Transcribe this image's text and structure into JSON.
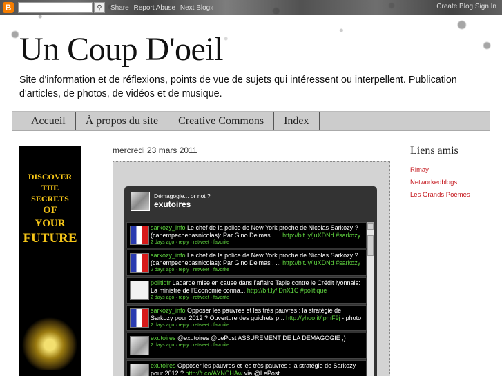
{
  "navbar": {
    "logo": "B",
    "search_value": "",
    "links": [
      "Share",
      "Report Abuse",
      "Next Blog»"
    ],
    "right_links": [
      "Create Blog",
      "Sign In"
    ]
  },
  "header": {
    "title": "Un Coup D'oeil",
    "description": "Site d'information et de réflexions, points de vue de sujets qui intéressent ou interpellent. Publication d'articles, de photos, de vidéos et de musique."
  },
  "tabs": [
    {
      "label": "Accueil"
    },
    {
      "label": "À propos du site"
    },
    {
      "label": "Creative Commons"
    },
    {
      "label": "Index"
    }
  ],
  "left_ad": {
    "lines": [
      "DISCOVER",
      "THE",
      "SECRETS",
      "OF",
      "YOUR",
      "FUTURE"
    ],
    "colors": {
      "text": "#f5c518",
      "background": "#000000"
    }
  },
  "post": {
    "date": "mercredi 23 mars 2011"
  },
  "twitter_widget": {
    "subtitle": "Démagogie... or not ?",
    "title": "exutoires",
    "tweets": [
      {
        "user": "sarkozy_info",
        "text": " Le chef de la police de New York proche de Nicolas Sarkozy ? (canempechepasnicolas): Par Gino Delmas , ... ",
        "link": "http://bit.ly/juXDNd",
        "tag": " #sarkozy",
        "meta": "2 days ago · reply · retweet · favorite",
        "pic": "flag"
      },
      {
        "user": "sarkozy_info",
        "text": " Le chef de la police de New York proche de Nicolas Sarkozy ? (canempechepasnicolas): Par Gino Delmas , ... ",
        "link": "http://bit.ly/juXDNd",
        "tag": " #sarkozy",
        "meta": "2 days ago · reply · retweet · favorite",
        "pic": "flag"
      },
      {
        "user": "politiqfr",
        "text": " Lagarde mise en cause dans l'affaire Tapie contre le Crédit lyonnais: La ministre de l'Economie conna... ",
        "link": "http://bit.ly/lDnX1C",
        "tag": " #politique",
        "meta": "2 days ago · reply · retweet · favorite",
        "pic": "light"
      },
      {
        "user": "sarkozy_info",
        "text": " Opposer les pauvres et les très pauvres : la stratégie de Sarkozy pour 2012 ? Ouverture des guichets p... ",
        "link": "http://yhoo.it/lpmF9j",
        "tag": " - photo",
        "meta": "2 days ago · reply · retweet · favorite",
        "pic": "flag"
      },
      {
        "user": "exutoires",
        "text": " @exutoires @LePost ASSUREMENT DE LA DEMAGOGIE ;)",
        "link": "",
        "tag": "",
        "meta": "2 days ago · reply · retweet · favorite",
        "pic": "gray"
      },
      {
        "user": "exutoires",
        "text": " Opposer les pauvres et les très pauvres : la stratégie de Sarkozy pour 2012 ? ",
        "link": "http://t.co/AYNCHAw",
        "tag": " via @LePost",
        "meta": "",
        "pic": "gray"
      }
    ],
    "colors": {
      "background": "#333333",
      "link": "#5fd33f",
      "tweet_bg": "#000000"
    }
  },
  "sidebar": {
    "title": "Liens amis",
    "links": [
      "Rimay",
      "Networkedblogs",
      "Les Grands Poèmes"
    ],
    "colors": {
      "link": "#c4161c"
    }
  }
}
